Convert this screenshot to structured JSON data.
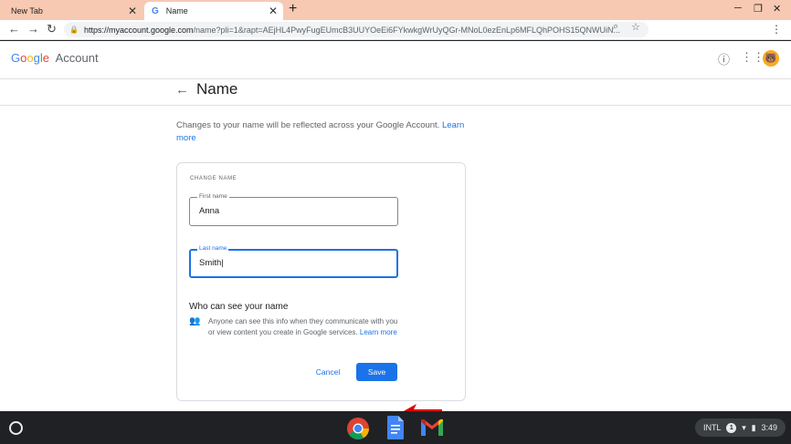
{
  "browser": {
    "tabs": [
      {
        "title": "New Tab",
        "active": false
      },
      {
        "title": "Name",
        "active": true
      }
    ],
    "new_tab": "+",
    "url_host": "https://myaccount.google.com",
    "url_path": "/name?pli=1&rapt=AEjHL4PwyFugEUmcB3UUYOeEi6FYkwkgWrUyQGr-MNoL0ezEnLp6MFLQhPOHS15QNWUiN...",
    "icons": [
      "back-icon",
      "forward-icon",
      "reload-icon",
      "lock-icon",
      "zoom-icon",
      "star-icon",
      "menu-icon"
    ]
  },
  "header": {
    "logo": {
      "g": "G",
      "o1": "o",
      "o2": "o",
      "g2": "g",
      "l": "l",
      "e": "e"
    },
    "account_label": "Account",
    "icons": [
      "help-icon",
      "apps-icon",
      "avatar"
    ]
  },
  "main": {
    "title": "Name",
    "intro_text": "Changes to your name will be reflected across your Google Account.",
    "intro_link": "Learn more",
    "card": {
      "heading": "CHANGE NAME",
      "first_name": {
        "label": "First name",
        "value": "Anna"
      },
      "last_name": {
        "label": "Last name",
        "value": "Smith|"
      },
      "who_title": "Who can see your name",
      "who_text": "Anyone can see this info when they communicate with you or view content you create in Google services.",
      "who_link": "Learn more",
      "cancel_label": "Cancel",
      "save_label": "Save"
    }
  },
  "shelf": {
    "apps": [
      "chrome-icon",
      "docs-icon",
      "gmail-icon"
    ],
    "ime": "INTL",
    "notifications": "1",
    "time": "3:49"
  },
  "colors": {
    "accent": "#1a73e8",
    "tabstrip": "#f7c9b2",
    "annotation_arrow": "#e00000"
  }
}
